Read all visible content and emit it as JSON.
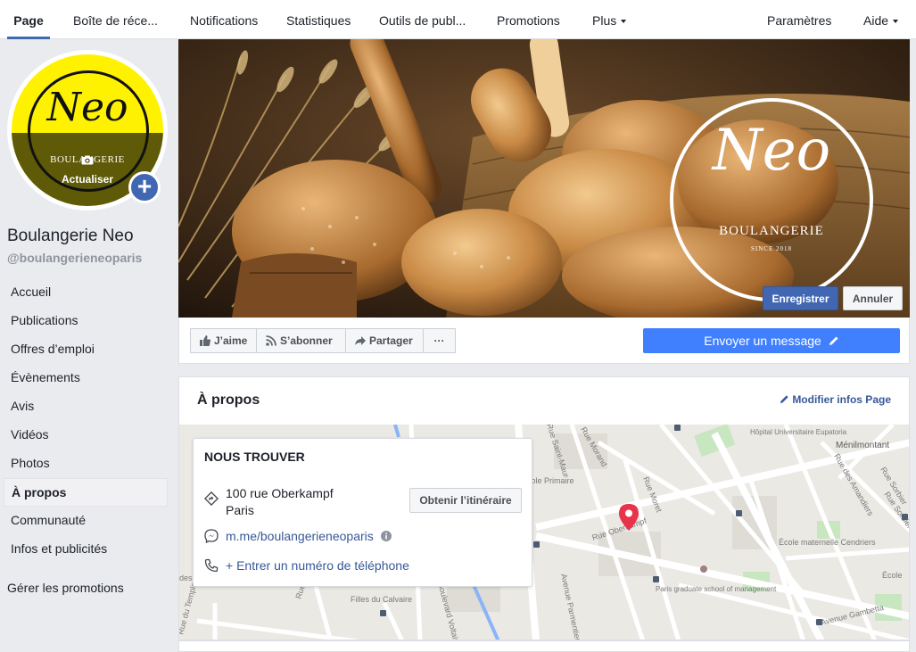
{
  "topnav": {
    "tabs": [
      {
        "label": "Page"
      },
      {
        "label": "Boîte de réce..."
      },
      {
        "label": "Notifications"
      },
      {
        "label": "Statistiques"
      },
      {
        "label": "Outils de publ..."
      },
      {
        "label": "Promotions"
      },
      {
        "label": "Plus"
      }
    ],
    "settings": "Paramètres",
    "help": "Aide"
  },
  "profile": {
    "logo_text": "Neo",
    "logo_sub": "BOULANGERIE",
    "update_label": "Actualiser",
    "name": "Boulangerie Neo",
    "handle": "@boulangerieneoparis"
  },
  "sidebar": {
    "items": [
      {
        "label": "Accueil"
      },
      {
        "label": "Publications"
      },
      {
        "label": "Offres d’emploi"
      },
      {
        "label": "Évènements"
      },
      {
        "label": "Avis"
      },
      {
        "label": "Vidéos"
      },
      {
        "label": "Photos"
      },
      {
        "label": "À propos"
      },
      {
        "label": "Communauté"
      },
      {
        "label": "Infos et publicités"
      }
    ],
    "promotions": "Gérer les promotions"
  },
  "cover": {
    "logo_text": "Neo",
    "logo_sub": "BOULANGERIE",
    "logo_since": "SINCE 2018",
    "save_label": "Enregistrer",
    "cancel_label": "Annuler"
  },
  "actions": {
    "like": "J’aime",
    "follow": "S’abonner",
    "share": "Partager",
    "more": "···",
    "send_message": "Envoyer un message"
  },
  "about": {
    "title": "À propos",
    "edit": "Modifier infos Page",
    "find_title": "NOUS TROUVER",
    "address_line1": "100 rue Oberkampf",
    "address_line2": "Paris",
    "route_label": "Obtenir l’itinéraire",
    "messenger": "m.me/boulangerieneoparis",
    "phone": "+ Entrer un numéro de téléphone"
  },
  "map": {
    "labels": [
      {
        "text": "Ménilmontant"
      },
      {
        "text": "Hôpital Universitaire Eupatoria"
      },
      {
        "text": "École Primaire"
      },
      {
        "text": "Rue Oberkampf"
      },
      {
        "text": "École maternelle Cendriers"
      },
      {
        "text": "Filles du Calvaire"
      },
      {
        "text": "Paris graduate school of management"
      },
      {
        "text": "Avenue Gambetta"
      },
      {
        "text": "Rue Morand"
      },
      {
        "text": "Rue Moret"
      },
      {
        "text": "Rue Saint-Maur"
      },
      {
        "text": "Rue des Amandiers"
      },
      {
        "text": "Rue Sorbier"
      },
      {
        "text": "Avenue Parmentier"
      },
      {
        "text": "Boulevard Voltaire"
      },
      {
        "text": "Rue Charlot"
      },
      {
        "text": "Rue du Temple"
      },
      {
        "text": "des Vertus"
      },
      {
        "text": "École"
      },
      {
        "text": "Rue Sorbier"
      }
    ]
  },
  "colors": {
    "brand_blue": "#4267b2",
    "messenger_blue": "#4080ff",
    "link_blue": "#385898",
    "profile_yellow": "#fff200",
    "map_pin": "#e8334a"
  }
}
